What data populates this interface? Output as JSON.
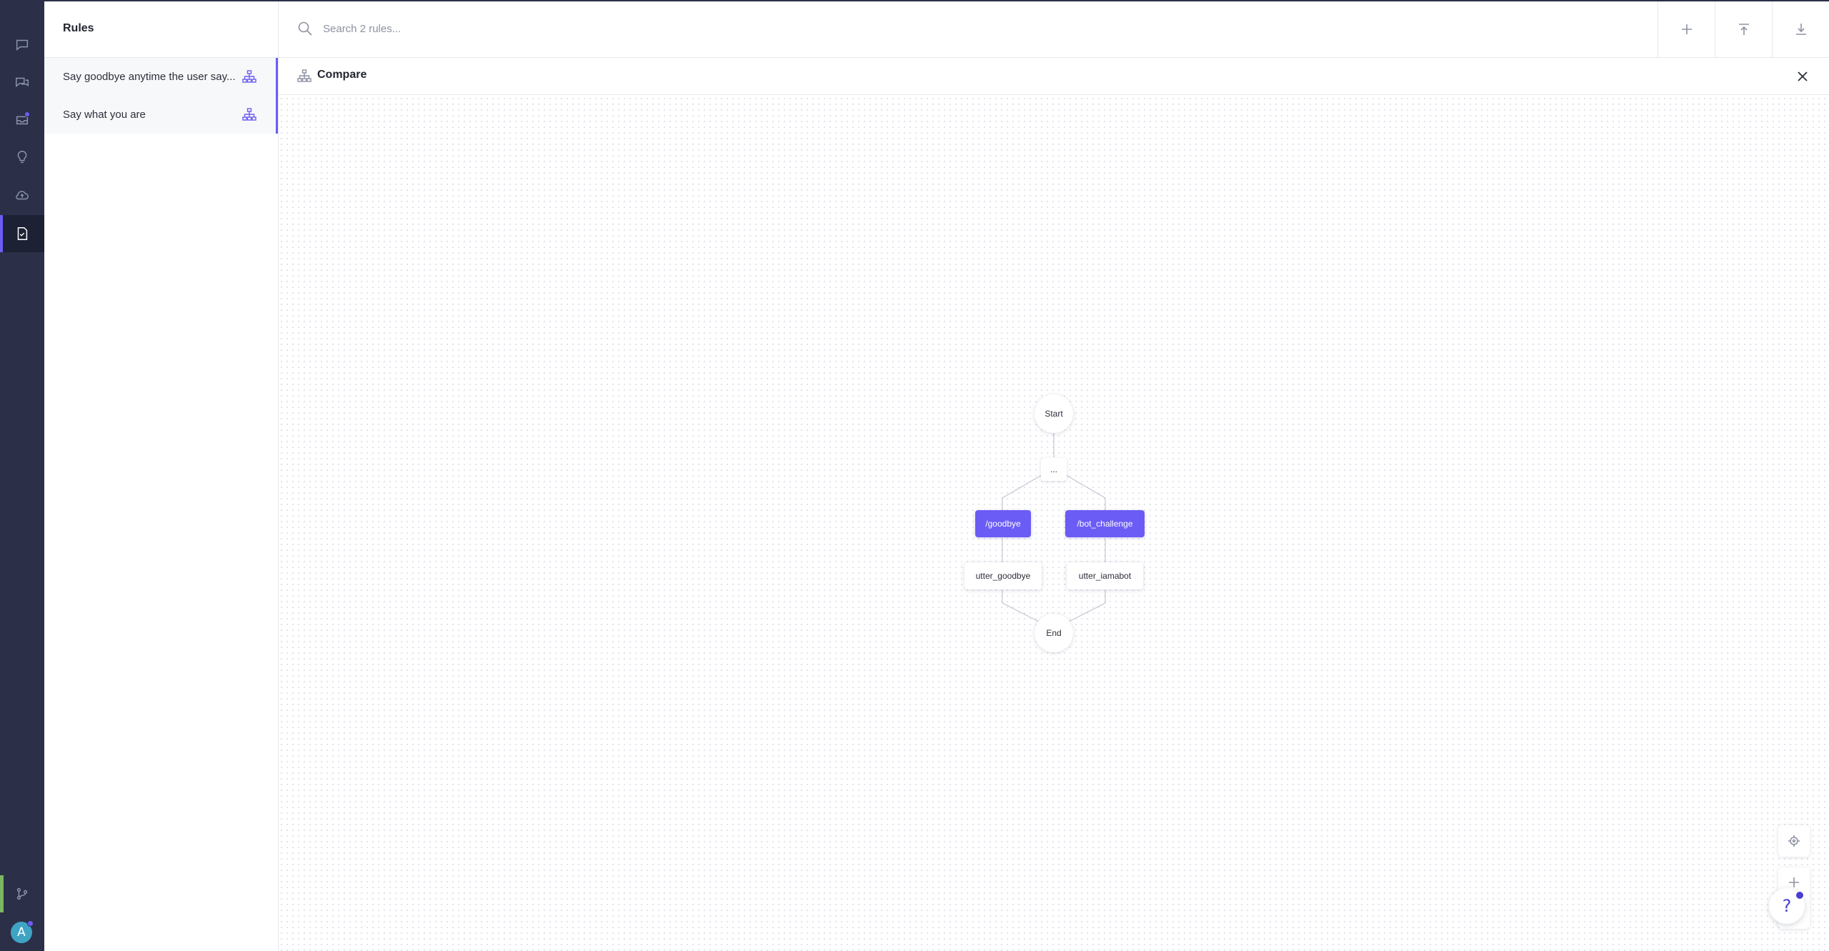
{
  "sidebar": {
    "title": "Rules",
    "items": [
      {
        "label": "Say goodbye anytime the user say..."
      },
      {
        "label": "Say what you are"
      }
    ]
  },
  "search": {
    "placeholder": "Search 2 rules..."
  },
  "compare": {
    "title": "Compare"
  },
  "graph": {
    "start": "Start",
    "ellipsis": "...",
    "intent_left": "/goodbye",
    "intent_right": "/bot_challenge",
    "action_left": "utter_goodbye",
    "action_right": "utter_iamabot",
    "end": "End"
  },
  "user": {
    "initial": "A"
  },
  "help": {
    "label": "?"
  },
  "colors": {
    "accent": "#6b5cf5",
    "rail": "#2b3048",
    "git": "#7bb662"
  }
}
